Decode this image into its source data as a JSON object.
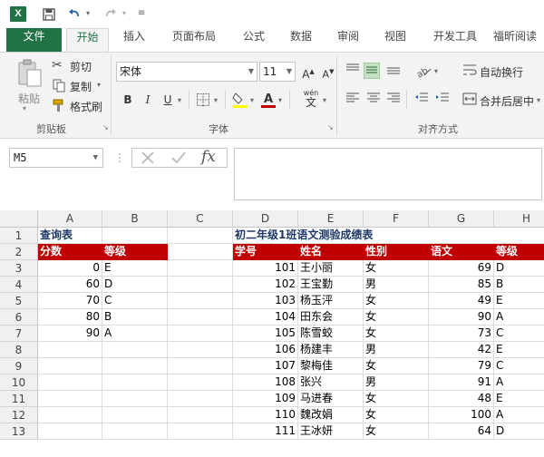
{
  "app": {
    "logo_letter": "X",
    "quick_access": [
      "save-icon",
      "undo-icon",
      "redo-icon",
      "customize-icon"
    ]
  },
  "tabs": [
    "文件",
    "开始",
    "插入",
    "页面布局",
    "公式",
    "数据",
    "审阅",
    "视图",
    "开发工具",
    "福昕阅读"
  ],
  "active_tab": "开始",
  "colors": {
    "excel_green": "#217346",
    "header_red": "#c00000",
    "title_blue": "#1f3864"
  },
  "clipboard": {
    "paste_label": "粘贴",
    "cut_label": "剪切",
    "copy_label": "复制",
    "format_painter_label": "格式刷",
    "group_label": "剪贴板"
  },
  "font": {
    "name": "宋体",
    "size": "11",
    "bold": "B",
    "italic": "I",
    "underline": "U",
    "font_color_glyph": "A",
    "wen_glyph": "wén",
    "wen_char": "文",
    "group_label": "字体"
  },
  "alignment": {
    "wrap_text_label": "自动换行",
    "merge_center_label": "合并后居中",
    "group_label": "对齐方式"
  },
  "formula_bar": {
    "name_box": "M5",
    "formula": "",
    "fx_label": "fx"
  },
  "columns": [
    "A",
    "B",
    "C",
    "D",
    "E",
    "F",
    "G",
    "H"
  ],
  "rows": [
    "1",
    "2",
    "3",
    "4",
    "5",
    "6",
    "7",
    "8",
    "9",
    "10",
    "11",
    "12",
    "13"
  ],
  "lookup_table": {
    "title": "查询表",
    "headers": [
      "分数",
      "等级"
    ],
    "rows": [
      [
        "0",
        "E"
      ],
      [
        "60",
        "D"
      ],
      [
        "70",
        "C"
      ],
      [
        "80",
        "B"
      ],
      [
        "90",
        "A"
      ]
    ]
  },
  "grade_table": {
    "title": "初二年级1班语文测验成绩表",
    "headers": [
      "学号",
      "姓名",
      "性别",
      "语文",
      "等级"
    ],
    "rows": [
      [
        "101",
        "王小丽",
        "女",
        "69",
        "D"
      ],
      [
        "102",
        "王宝勤",
        "男",
        "85",
        "B"
      ],
      [
        "103",
        "杨玉泙",
        "女",
        "49",
        "E"
      ],
      [
        "104",
        "田东会",
        "女",
        "90",
        "A"
      ],
      [
        "105",
        "陈雪蛟",
        "女",
        "73",
        "C"
      ],
      [
        "106",
        "杨建丰",
        "男",
        "42",
        "E"
      ],
      [
        "107",
        "黎梅佳",
        "女",
        "79",
        "C"
      ],
      [
        "108",
        "张兴",
        "男",
        "91",
        "A"
      ],
      [
        "109",
        "马进春",
        "女",
        "48",
        "E"
      ],
      [
        "110",
        "魏改娟",
        "女",
        "100",
        "A"
      ],
      [
        "111",
        "王冰妍",
        "女",
        "64",
        "D"
      ]
    ]
  }
}
